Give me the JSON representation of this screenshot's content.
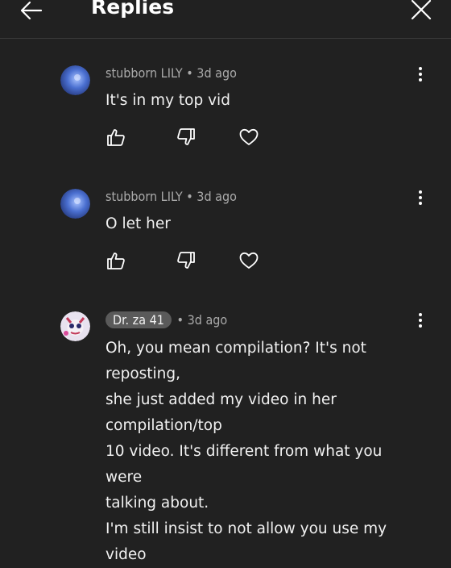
{
  "header": {
    "title": "Replies"
  },
  "comments": [
    {
      "author": "stubborn LILY",
      "separator": "•",
      "time": "3d ago",
      "text": "It's in my top vid",
      "avatar_color": "#4a6fd0"
    },
    {
      "author": "stubborn LILY",
      "separator": "•",
      "time": "3d ago",
      "text": "O let her",
      "avatar_color": "#4a6fd0"
    },
    {
      "author": "Dr. za 41",
      "separator": "•",
      "time": "3d ago",
      "text_lines": [
        "Oh, you mean compilation? It's not reposting,",
        "she just added my video in her compilation/top",
        "10 video. It's different from what you were",
        "talking about.",
        "I'm still insist to not allow you use my video"
      ],
      "avatar_color": "#e8e2ef"
    }
  ],
  "icons": {
    "back": "arrow-left-icon",
    "close": "close-icon",
    "like": "thumbs-up-icon",
    "dislike": "thumbs-down-icon",
    "heart": "heart-icon",
    "more": "more-vertical-icon"
  }
}
